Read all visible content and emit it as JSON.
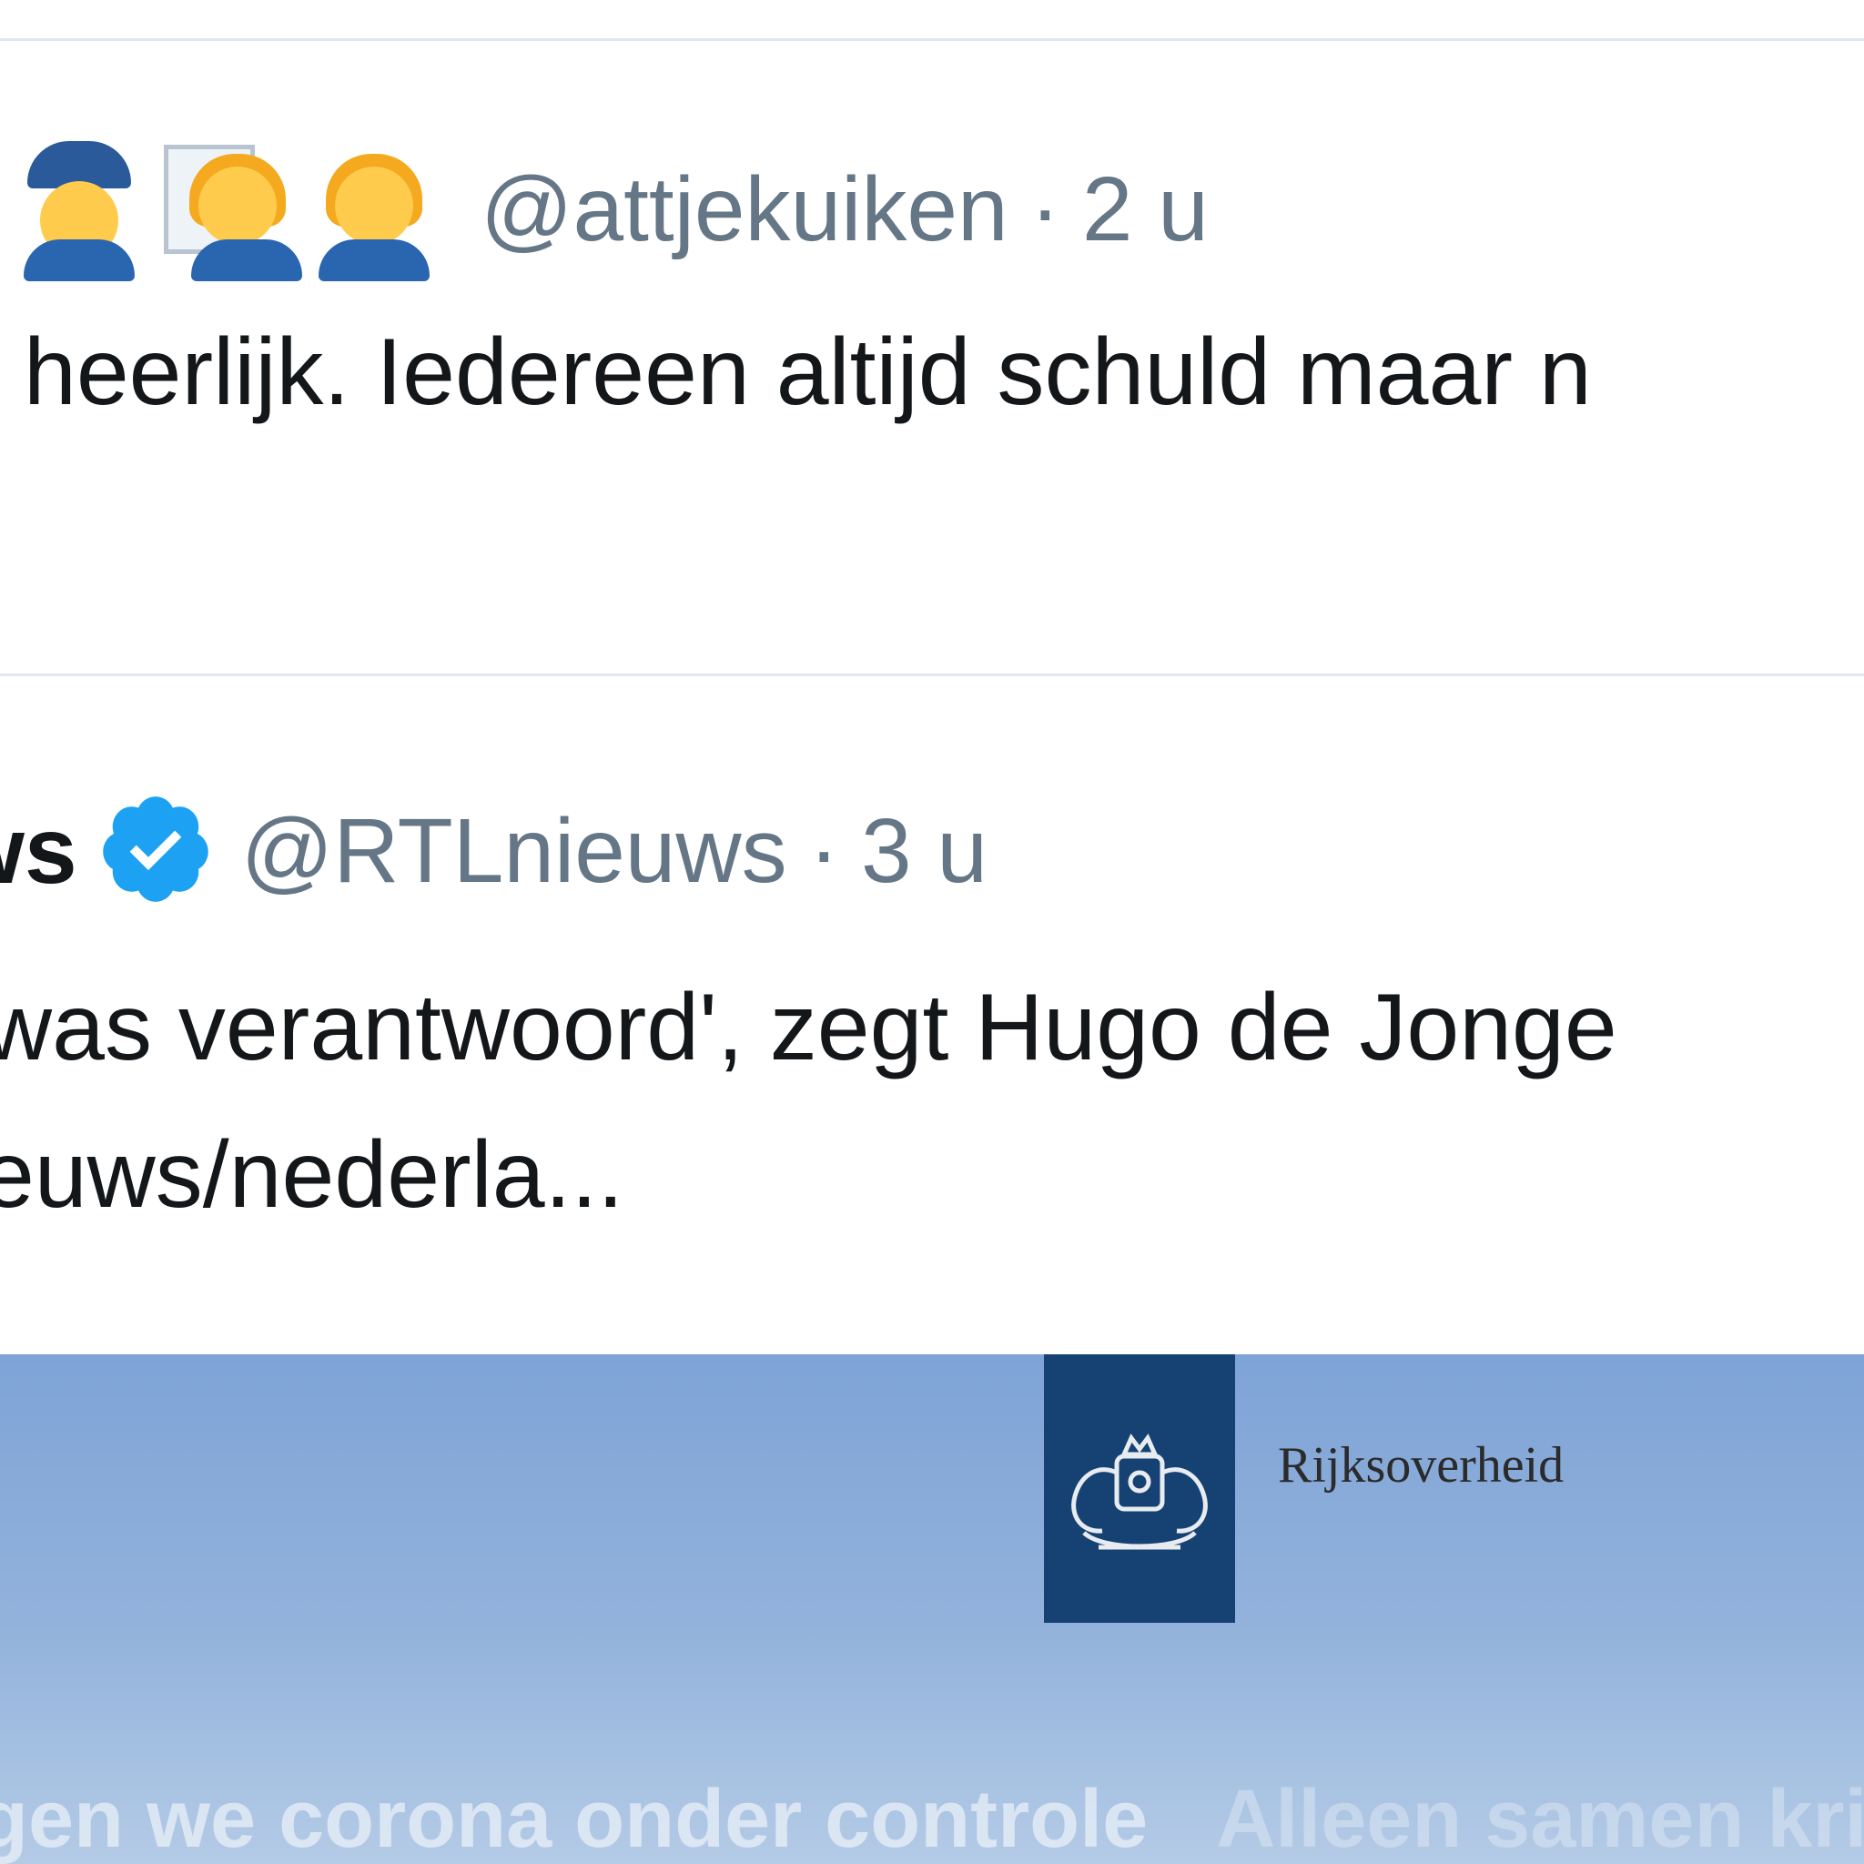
{
  "tweet1": {
    "handle": "@attjekuiken",
    "separator": "·",
    "time": "2 u",
    "text": "heerlijk. Iedereen altijd schuld maar n"
  },
  "tweet2": {
    "author_partial": "ws",
    "handle": "@RTLnieuws",
    "separator": "·",
    "time": "3 u",
    "text_line1": "was verantwoord', zegt Hugo de Jonge",
    "text_line2": "euws/nederla..."
  },
  "media": {
    "brand": "Rijksoverheid",
    "slogan_part1": "gen we corona onder controle",
    "slogan_part2": "Alleen samen kri",
    "background": "#7ea3d6",
    "logo_color": "#154273"
  },
  "colors": {
    "text": "#14171a",
    "secondary": "#657786",
    "verified": "#1da1f2",
    "divider": "#e1e8ed"
  }
}
